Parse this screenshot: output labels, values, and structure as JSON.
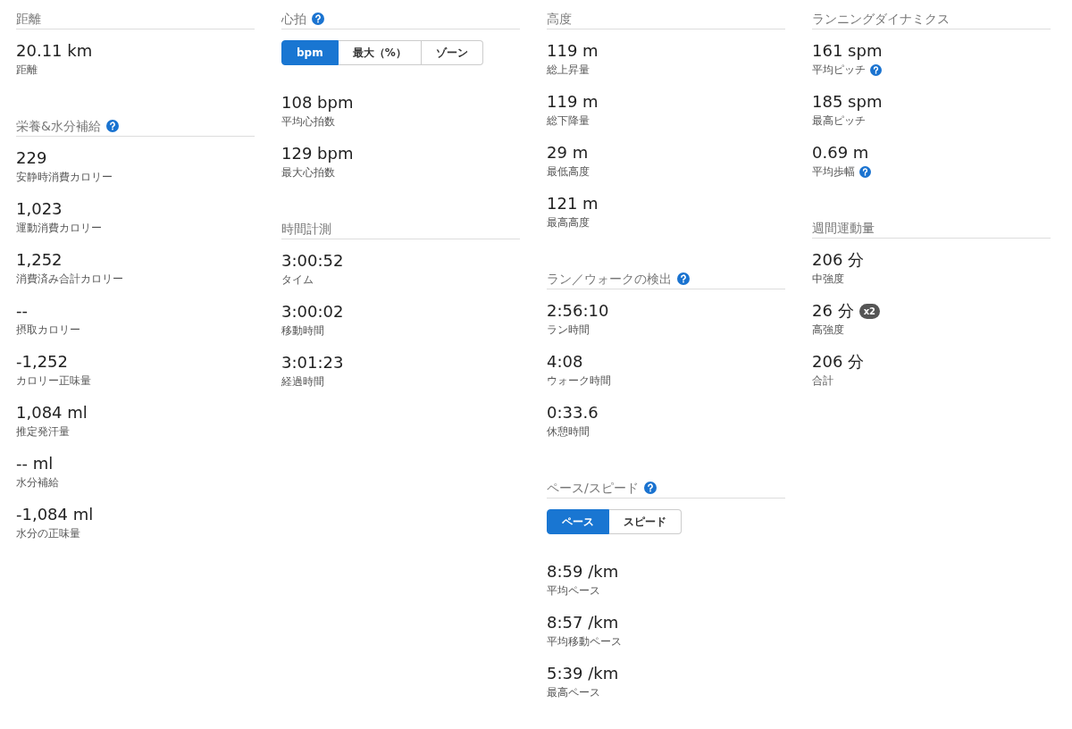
{
  "columns": [
    [
      {
        "title": "距離",
        "help": false,
        "stats": [
          {
            "value": "20.11 km",
            "label": "距離",
            "help": false
          }
        ]
      },
      {
        "title": "栄養&水分補給",
        "help": true,
        "stats": [
          {
            "value": "229",
            "label": "安静時消費カロリー",
            "help": false
          },
          {
            "value": "1,023",
            "label": "運動消費カロリー",
            "help": false
          },
          {
            "value": "1,252",
            "label": "消費済み合計カロリー",
            "help": false
          },
          {
            "value": "--",
            "label": "摂取カロリー",
            "help": false
          },
          {
            "value": "-1,252",
            "label": "カロリー正味量",
            "help": false
          },
          {
            "value": "1,084 ml",
            "label": "推定発汗量",
            "help": false
          },
          {
            "value": "-- ml",
            "label": "水分補給",
            "help": false
          },
          {
            "value": "-1,084 ml",
            "label": "水分の正味量",
            "help": false
          }
        ]
      }
    ],
    [
      {
        "title": "心拍",
        "help": true,
        "toggle": [
          {
            "label": "bpm",
            "selected": true
          },
          {
            "label": "最大（%）",
            "selected": false
          },
          {
            "label": "ゾーン",
            "selected": false
          }
        ],
        "stats": [
          {
            "value": "108 bpm",
            "label": "平均心拍数",
            "help": false
          },
          {
            "value": "129 bpm",
            "label": "最大心拍数",
            "help": false
          }
        ]
      },
      {
        "title": "時間計測",
        "help": false,
        "stats": [
          {
            "value": "3:00:52",
            "label": "タイム",
            "help": false
          },
          {
            "value": "3:00:02",
            "label": "移動時間",
            "help": false
          },
          {
            "value": "3:01:23",
            "label": "経過時間",
            "help": false
          }
        ]
      }
    ],
    [
      {
        "title": "高度",
        "help": false,
        "stats": [
          {
            "value": "119 m",
            "label": "総上昇量",
            "help": false
          },
          {
            "value": "119 m",
            "label": "総下降量",
            "help": false
          },
          {
            "value": "29 m",
            "label": "最低高度",
            "help": false
          },
          {
            "value": "121 m",
            "label": "最高高度",
            "help": false
          }
        ]
      },
      {
        "title": "ラン／ウォークの検出",
        "help": true,
        "stats": [
          {
            "value": "2:56:10",
            "label": "ラン時間",
            "help": false
          },
          {
            "value": "4:08",
            "label": "ウォーク時間",
            "help": false
          },
          {
            "value": "0:33.6",
            "label": "休憩時間",
            "help": false
          }
        ]
      },
      {
        "title": "ペース/スピード",
        "help": true,
        "toggle": [
          {
            "label": "ペース",
            "selected": true
          },
          {
            "label": "スピード",
            "selected": false
          }
        ],
        "stats": [
          {
            "value": "8:59 /km",
            "label": "平均ペース",
            "help": false
          },
          {
            "value": "8:57 /km",
            "label": "平均移動ペース",
            "help": false
          },
          {
            "value": "5:39 /km",
            "label": "最高ペース",
            "help": false
          }
        ]
      }
    ],
    [
      {
        "title": "ランニングダイナミクス",
        "help": false,
        "stats": [
          {
            "value": "161 spm",
            "label": "平均ピッチ",
            "help": true
          },
          {
            "value": "185 spm",
            "label": "最高ピッチ",
            "help": false
          },
          {
            "value": "0.69 m",
            "label": "平均歩幅",
            "help": true
          }
        ]
      },
      {
        "title": "週間運動量",
        "help": false,
        "stats": [
          {
            "value": "206 分",
            "label": "中強度",
            "help": false
          },
          {
            "value": "26 分",
            "badge": "x2",
            "label": "高強度",
            "help": false
          },
          {
            "value": "206 分",
            "label": "合計",
            "help": false
          }
        ]
      }
    ]
  ]
}
